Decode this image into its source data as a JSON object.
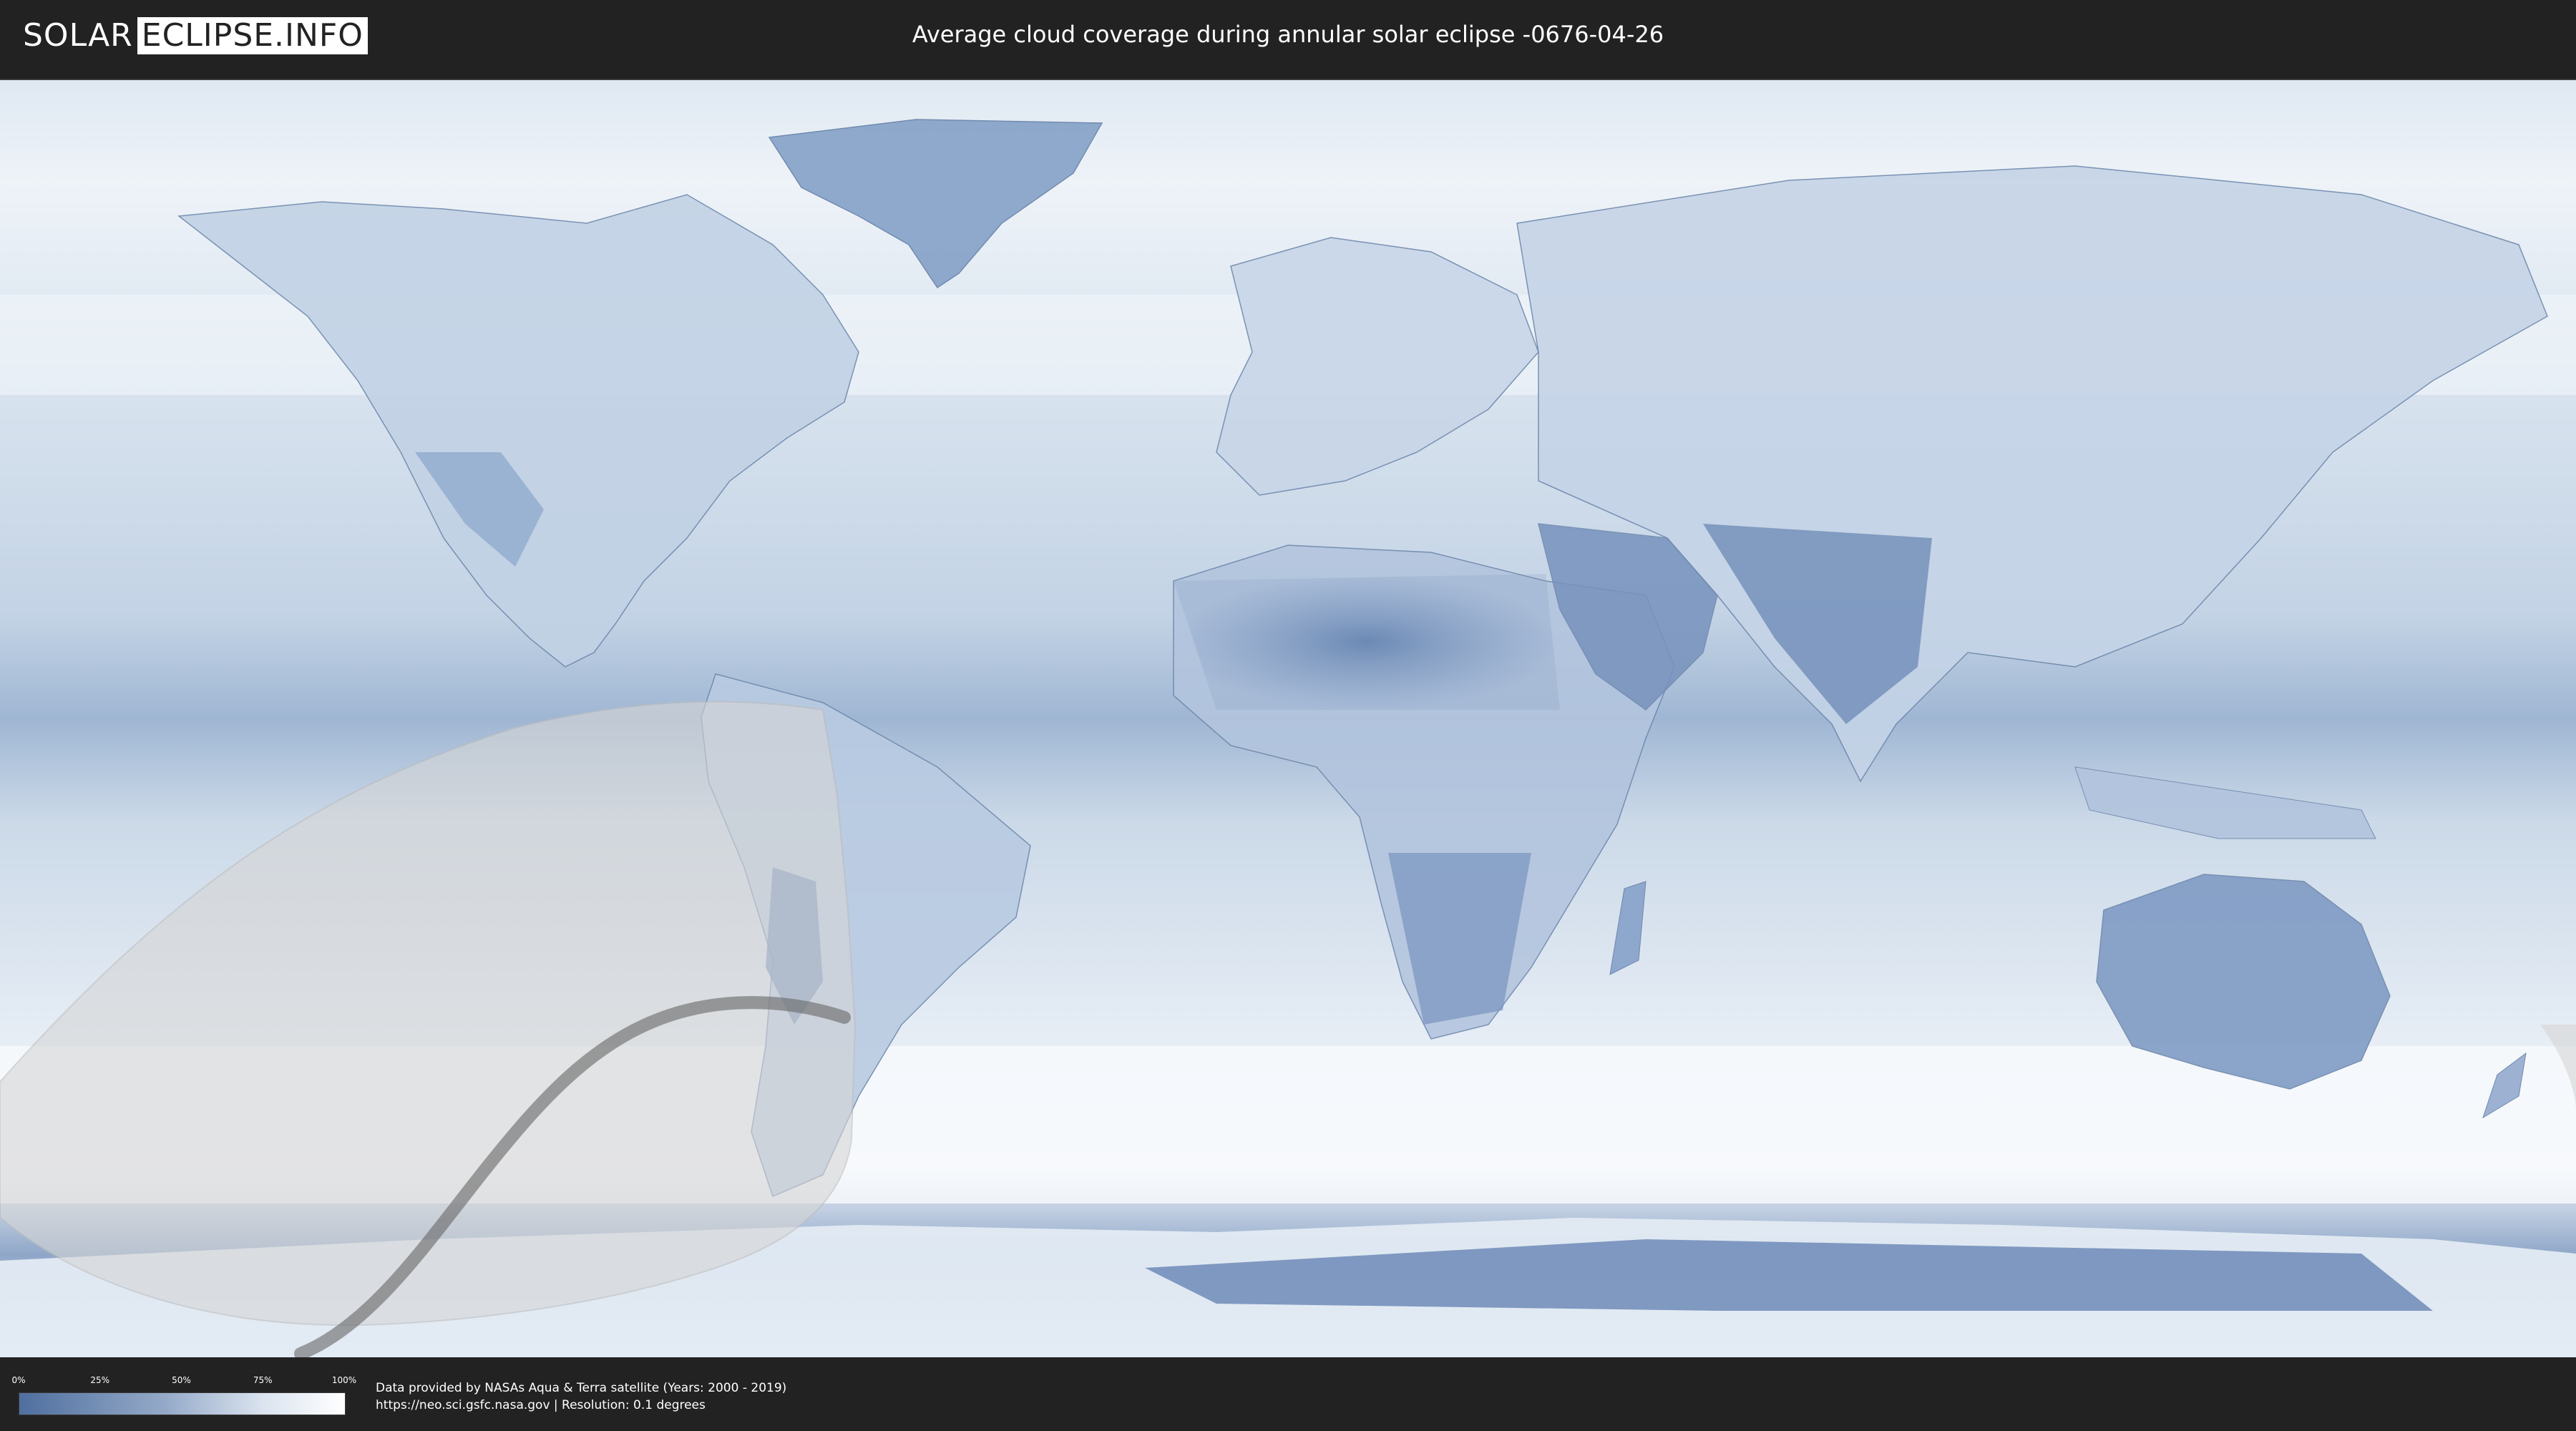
{
  "header": {
    "logo_left": "SOLAR",
    "logo_right": "ECLIPSE.INFO",
    "title": "Average cloud coverage during annular solar eclipse -0676-04-26"
  },
  "legend": {
    "ticks": [
      "0%",
      "25%",
      "50%",
      "75%",
      "100%"
    ],
    "colors": {
      "low": "#4f6f9f",
      "mid": "#95aac9",
      "high": "#ffffff"
    }
  },
  "credits": {
    "line1": "Data provided by NASAs Aqua & Terra satellite (Years: 2000 - 2019)",
    "line2": "https://neo.sci.gsfc.nasa.gov | Resolution: 0.1 degrees"
  },
  "map": {
    "cloud_color": "#ffffff",
    "clear_color": "#5d7fae",
    "eclipse_shade_color": "#d9d9d9",
    "eclipse_path_color": "#666666"
  }
}
